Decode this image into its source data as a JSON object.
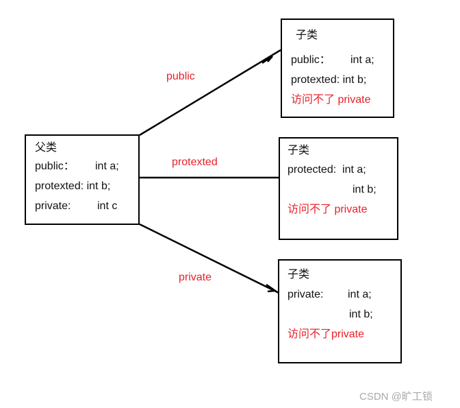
{
  "parent": {
    "title": "父类",
    "lines": [
      "public：",
      "int a;",
      "protexted: int b;",
      "private:",
      "int c"
    ]
  },
  "child1": {
    "title": "子类",
    "lines": [
      "public：",
      "int a;",
      "protexted: int b;",
      "访问不了 private"
    ]
  },
  "child2": {
    "title": "子类",
    "lines": [
      "protected:  int a;",
      "int b;",
      "访问不了 private"
    ]
  },
  "child3": {
    "title": "子类",
    "lines": [
      "private:",
      "int a;",
      "int b;",
      "访问不了private"
    ]
  },
  "edges": {
    "public_label": "public",
    "protected_label": "protexted",
    "private_label": "private"
  },
  "colors": {
    "line": "#000000",
    "accent": "#e8202a",
    "watermark": "#a9a9a9"
  },
  "watermark": "CSDN @旷工锁"
}
